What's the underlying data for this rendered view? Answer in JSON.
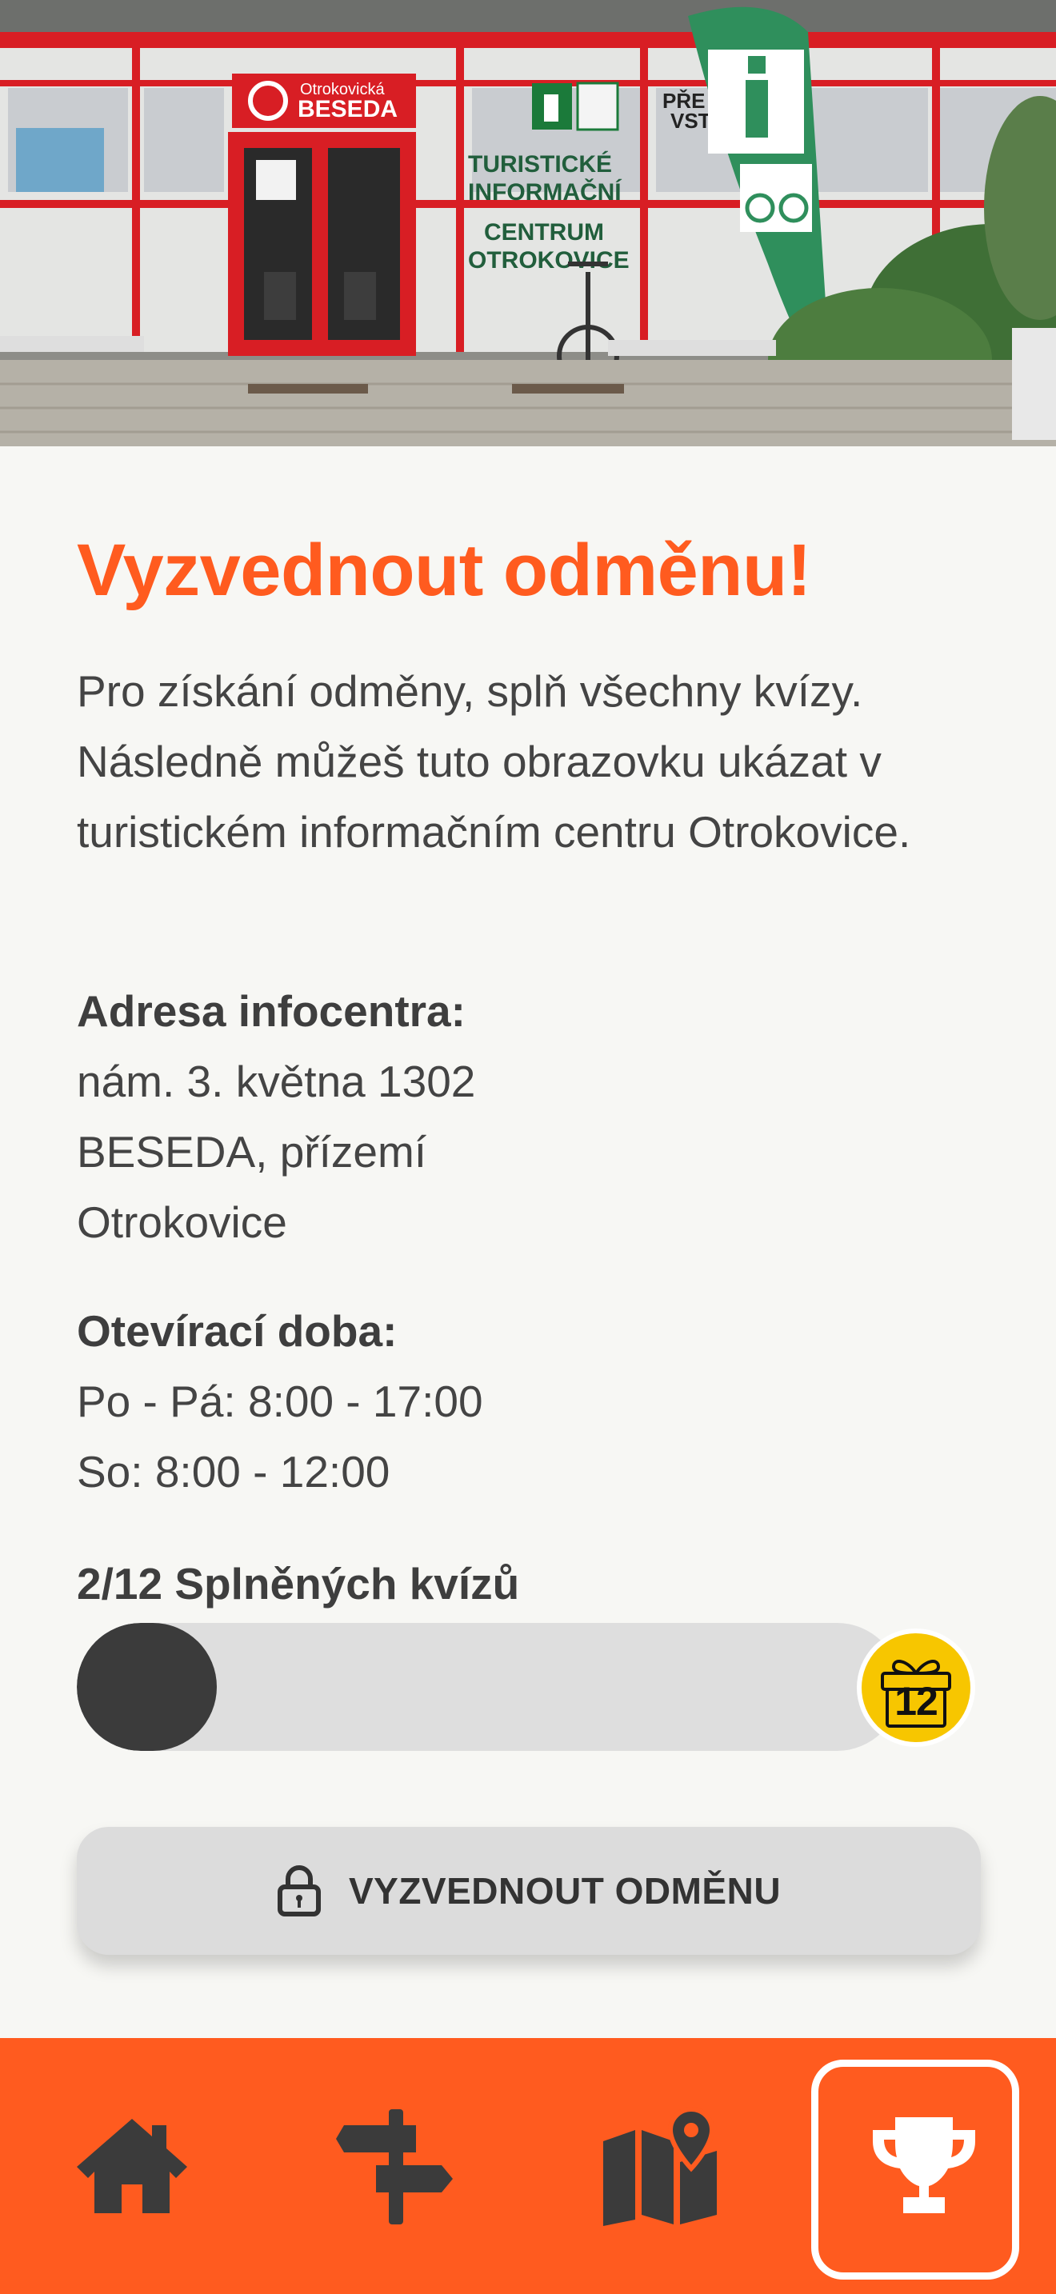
{
  "hero": {
    "sign_brand_small": "Otrokovická",
    "sign_brand": "BESEDA",
    "window_sign_lines": [
      "TURISTICKÉ",
      "INFORMAČNÍ",
      "CENTRUM",
      "OTROKOVICE"
    ],
    "partial_sign_lines": [
      "PŘE",
      "VST"
    ]
  },
  "reward": {
    "title": "Vyzvednout odměnu!",
    "intro": "Pro získání odměny, splň všechny kvízy. Následně můžeš tuto obrazovku ukázat v turistickém informačním centru Otrokovice.",
    "address_label": "Adresa infocentra:",
    "address_lines": [
      "nám. 3. května 1302",
      "BESEDA, přízemí",
      "Otrokovice"
    ],
    "hours_label": "Otevírací doba:",
    "hours_lines": [
      "Po - Pá: 8:00 - 17:00",
      "So: 8:00 - 12:00"
    ],
    "progress_label": "2/12 Splněných kvízů",
    "progress_completed": 2,
    "progress_total": 12,
    "goal_badge": "12",
    "claim_button": "VYZVEDNOUT ODMĚNU",
    "claim_icon": "lock-icon"
  },
  "nav": {
    "items": [
      {
        "icon": "home-icon",
        "active": false
      },
      {
        "icon": "signpost-icon",
        "active": false
      },
      {
        "icon": "map-icon",
        "active": false
      },
      {
        "icon": "trophy-icon",
        "active": true
      }
    ]
  },
  "colors": {
    "accent": "#ff5b1f",
    "progress_fill": "#3b3b3b",
    "progress_track": "#dedede",
    "badge_gold": "#f7c600",
    "background": "#f7f7f4"
  }
}
